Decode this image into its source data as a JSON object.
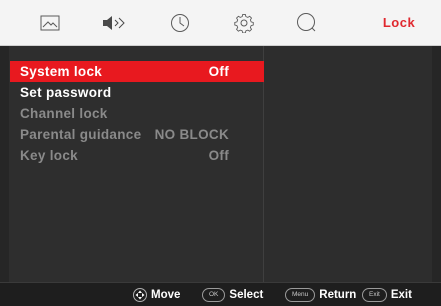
{
  "colors": {
    "accent": "#e0282e",
    "selected_bg": "#e8191f",
    "text_enabled": "#ffffff",
    "text_disabled": "#8a8a8a",
    "icon": "#5a5a5a"
  },
  "tabs": [
    {
      "icon": "picture-icon",
      "active": false
    },
    {
      "icon": "speaker-icon",
      "active": false
    },
    {
      "icon": "clock-icon",
      "active": false
    },
    {
      "icon": "gear-icon",
      "active": false
    },
    {
      "icon": "search-icon",
      "active": false
    },
    {
      "label": "Lock",
      "active": true
    }
  ],
  "menu": {
    "items": [
      {
        "label": "System lock",
        "value": "Off",
        "selected": true,
        "enabled": true
      },
      {
        "label": "Set password",
        "value": "",
        "selected": false,
        "enabled": true
      },
      {
        "label": "Channel lock",
        "value": "",
        "selected": false,
        "enabled": false
      },
      {
        "label": "Parental guidance",
        "value": "NO BLOCK",
        "selected": false,
        "enabled": false
      },
      {
        "label": "Key lock",
        "value": "Off",
        "selected": false,
        "enabled": false
      }
    ]
  },
  "footer": {
    "move": {
      "icon": "dpad-icon",
      "label": "Move"
    },
    "select": {
      "key": "OK",
      "label": "Select"
    },
    "return": {
      "key": "Menu",
      "label": "Return"
    },
    "exit": {
      "key": "Exit",
      "label": "Exit"
    }
  }
}
